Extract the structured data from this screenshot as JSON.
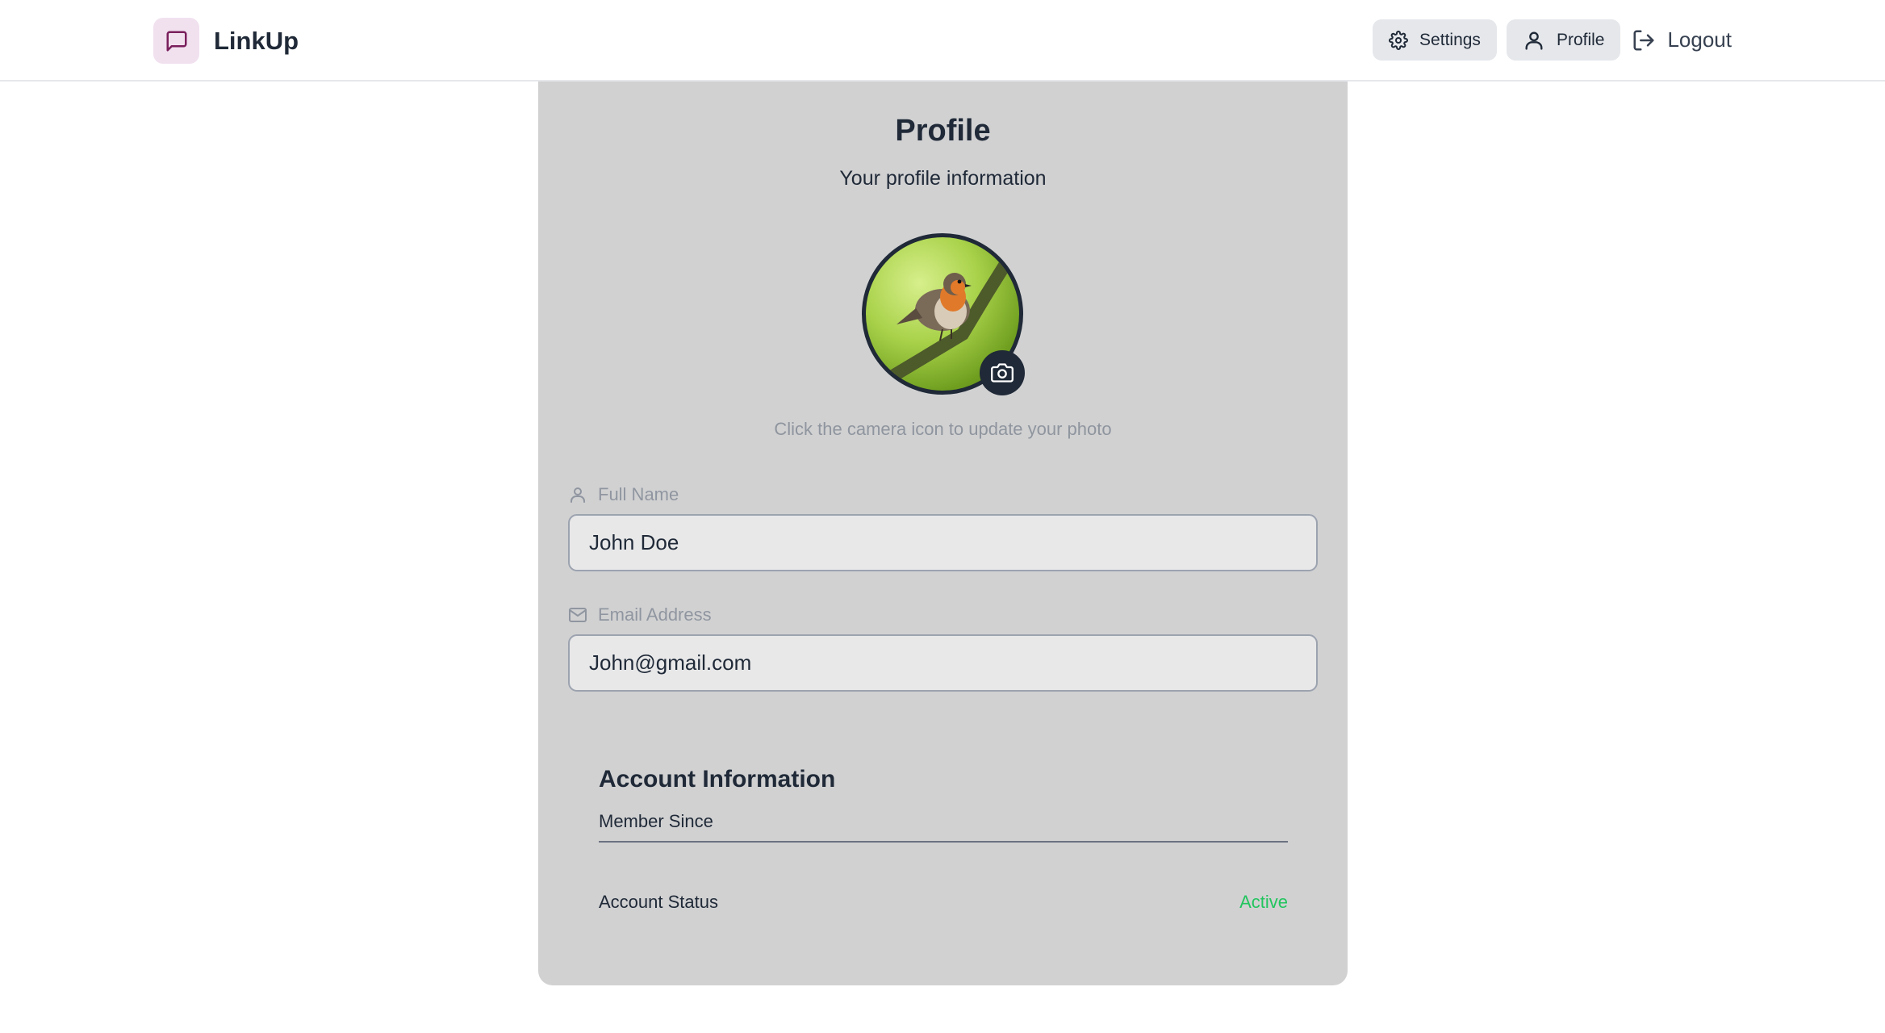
{
  "header": {
    "brand_name": "LinkUp",
    "settings_label": "Settings",
    "profile_label": "Profile",
    "logout_label": "Logout"
  },
  "profile": {
    "title": "Profile",
    "subtitle": "Your profile information",
    "photo_hint": "Click the camera icon to update your photo",
    "full_name": {
      "label": "Full Name",
      "value": "John Doe"
    },
    "email": {
      "label": "Email Address",
      "value": "John@gmail.com"
    }
  },
  "account": {
    "title": "Account Information",
    "member_since_label": "Member Since",
    "member_since_value": "",
    "status_label": "Account Status",
    "status_value": "Active"
  },
  "colors": {
    "brand_accent": "#7a1f5c",
    "card_background": "#d1d1d2",
    "status_active": "#22c55e",
    "dark": "#1f2937"
  },
  "icons": {
    "brand": "message-square-icon",
    "settings": "gear-icon",
    "profile": "user-icon",
    "logout": "logout-icon",
    "camera": "camera-icon",
    "full_name": "user-icon",
    "email": "mail-icon"
  }
}
